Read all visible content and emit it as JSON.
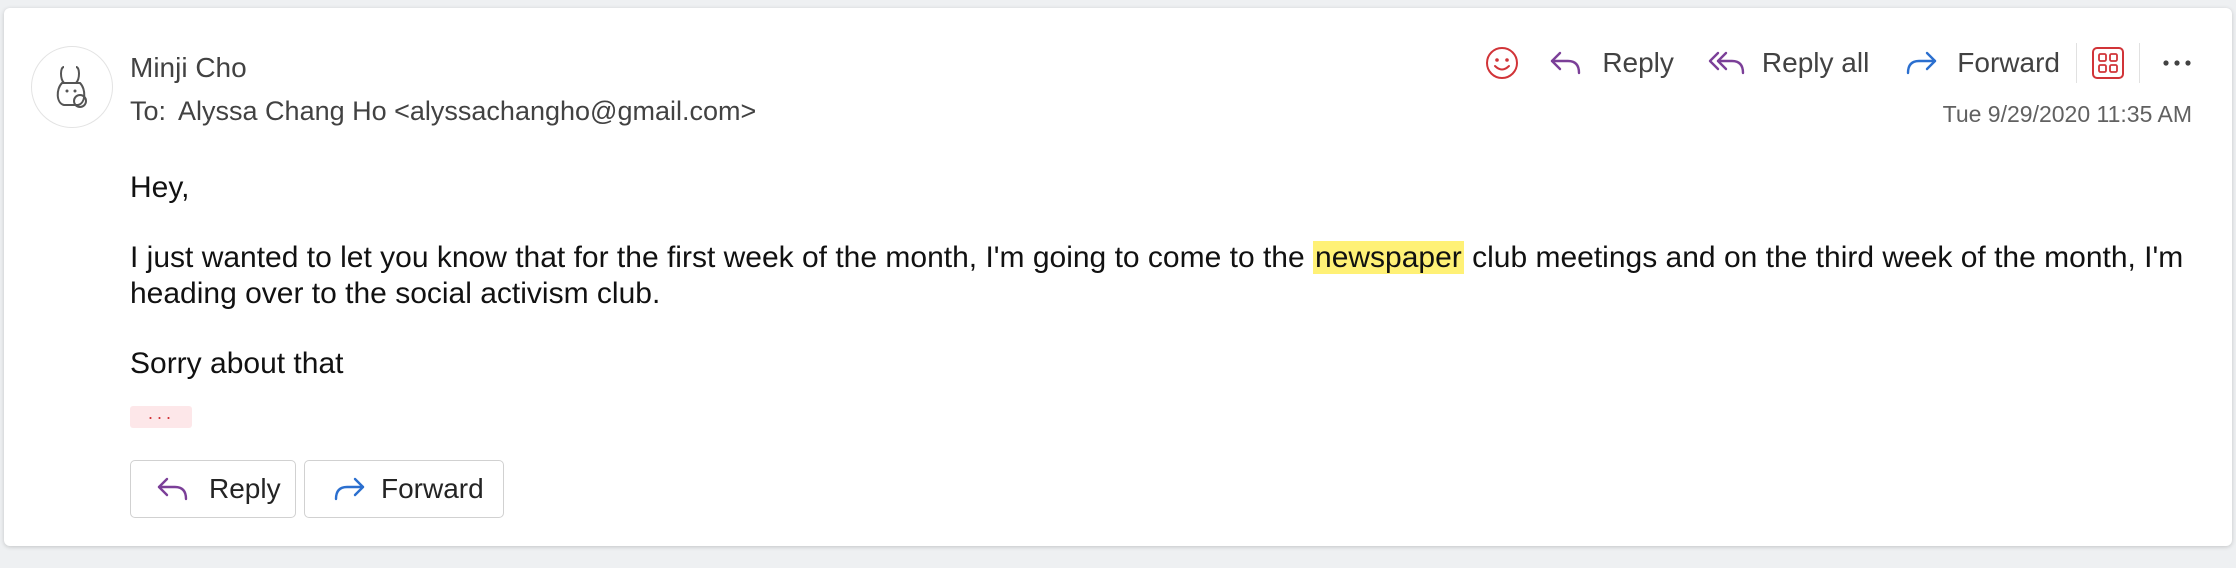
{
  "message": {
    "sender_name": "Minji Cho",
    "to_label": "To:",
    "to_value": "Alyssa Chang Ho <alyssachangho@gmail.com>",
    "timestamp": "Tue 9/29/2020 11:35 AM"
  },
  "toolbar": {
    "emoji_icon": "smiley-icon",
    "reply_label": "Reply",
    "reply_all_label": "Reply all",
    "forward_label": "Forward",
    "apps_icon": "apps-grid-icon",
    "more_icon": "more-horizontal-icon"
  },
  "body": {
    "greeting": "Hey,",
    "para_before": "I just wanted to let you know that for the first week of the month, I'm going to come to the ",
    "highlight": "newspaper",
    "para_after": " club meetings and on the third week of the month, I'm heading over to the social activism club.",
    "closing": "Sorry about that",
    "expand_indicator": "···"
  },
  "footer": {
    "reply_label": "Reply",
    "forward_label": "Forward"
  },
  "colors": {
    "reply_icon": "#7b3f98",
    "forward_icon": "#2b6fcf",
    "emoji_icon": "#d13438",
    "highlight": "#fff176"
  }
}
